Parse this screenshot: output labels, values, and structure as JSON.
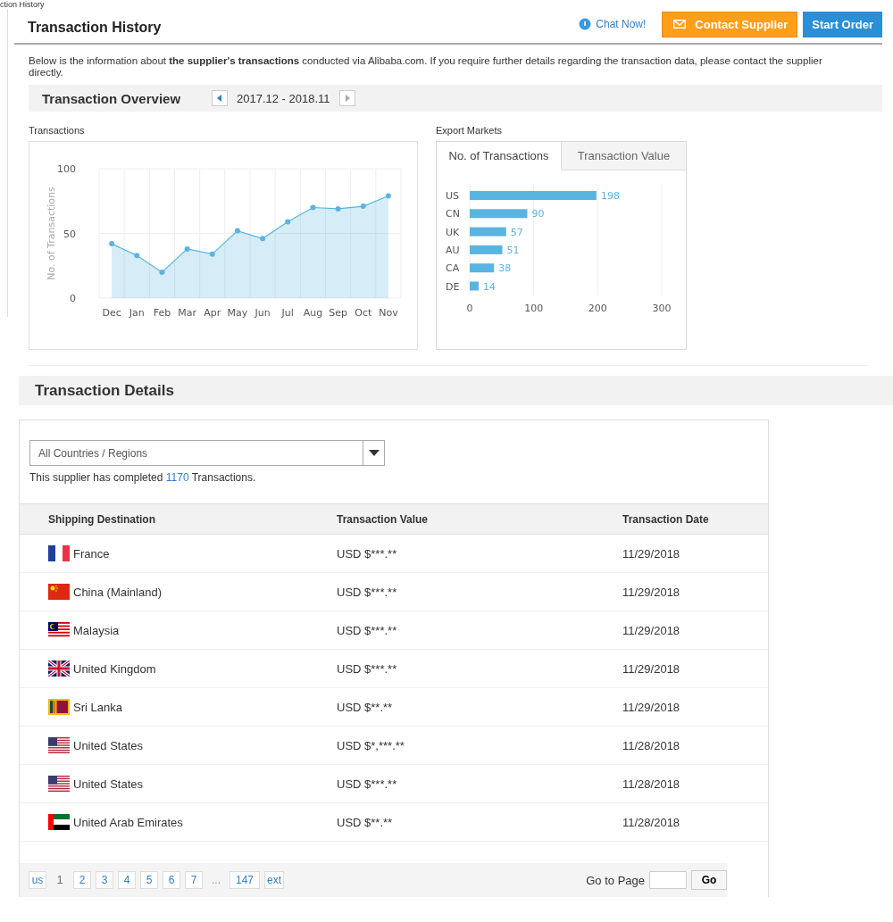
{
  "breadcrumb": "ction History",
  "header": {
    "title": "Transaction History",
    "chat": "Chat Now!",
    "contact": "Contact Supplier",
    "start": "Start Order"
  },
  "intro": "Below is the information about **the supplier's transactions** conducted via Alibaba.com. If you require further details regarding the transaction data, please contact the supplier directly.",
  "overview": {
    "title": "Transaction Overview",
    "range": "2017.12 - 2018.11"
  },
  "transactions_chart": {
    "label": "Transactions",
    "chart_data": {
      "type": "area",
      "ylabel": "No. of Transactions",
      "categories": [
        "Dec",
        "Jan",
        "Feb",
        "Mar",
        "Apr",
        "May",
        "Jun",
        "Jul",
        "Aug",
        "Sep",
        "Oct",
        "Nov"
      ],
      "ylim": [
        0,
        100
      ],
      "yticks": [
        0,
        50,
        100
      ],
      "series": [
        {
          "color": "#5ab4e0",
          "values": [
            42,
            33,
            20,
            38,
            34,
            52,
            46,
            59,
            70,
            69,
            71,
            79
          ]
        }
      ]
    }
  },
  "export_markets": {
    "label": "Export Markets",
    "tabs": [
      {
        "label": "No. of Transactions",
        "selected": true
      },
      {
        "label": "Transaction Value",
        "selected": false
      }
    ],
    "chart_data": {
      "type": "bar",
      "orientation": "horizontal",
      "categories": [
        "US",
        "CN",
        "UK",
        "AU",
        "CA",
        "DE"
      ],
      "xlim": [
        0,
        300
      ],
      "xticks": [
        0,
        100,
        200,
        300
      ],
      "data_labels": true,
      "series": [
        {
          "color": "#5ab4e0",
          "values": [
            198,
            90,
            57,
            51,
            38,
            14
          ]
        }
      ]
    }
  },
  "details": {
    "title": "Transaction Details",
    "filter": "All Countries / Regions",
    "summary_before": "This supplier has completed",
    "count": "1170",
    "summary_after": "Transactions."
  },
  "table": {
    "columns": [
      "Shipping Destination",
      "Transaction Value",
      "Transaction Date"
    ],
    "rows": [
      {
        "kind": "fr",
        "destination": "France",
        "value": "USD $***.**",
        "date": "11/29/2018"
      },
      {
        "kind": "cn",
        "destination": "China (Mainland)",
        "value": "USD $***.**",
        "date": "11/29/2018"
      },
      {
        "kind": "my",
        "destination": "Malaysia",
        "value": "USD $***.**",
        "date": "11/29/2018"
      },
      {
        "kind": "gb",
        "destination": "United Kingdom",
        "value": "USD $***.**",
        "date": "11/29/2018"
      },
      {
        "kind": "lk",
        "destination": "Sri Lanka",
        "value": "USD $**.**",
        "date": "11/29/2018"
      },
      {
        "kind": "us",
        "destination": "United States",
        "value": "USD $*,***.**",
        "date": "11/28/2018"
      },
      {
        "kind": "us",
        "destination": "United States",
        "value": "USD $***.**",
        "date": "11/28/2018"
      },
      {
        "kind": "ae",
        "destination": "United Arab Emirates",
        "value": "USD $**.**",
        "date": "11/28/2018"
      }
    ]
  },
  "pagination": {
    "prev": "us",
    "pages": [
      {
        "label": "1",
        "selected": true
      },
      {
        "label": "2",
        "selected": false
      },
      {
        "label": "3",
        "selected": false
      },
      {
        "label": "4",
        "selected": false
      },
      {
        "label": "5",
        "selected": false
      },
      {
        "label": "6",
        "selected": false
      },
      {
        "label": "7",
        "selected": false
      }
    ],
    "ellipsis": "...",
    "last": "147",
    "next": "ext",
    "goto": "Go to Page",
    "go": "Go"
  }
}
